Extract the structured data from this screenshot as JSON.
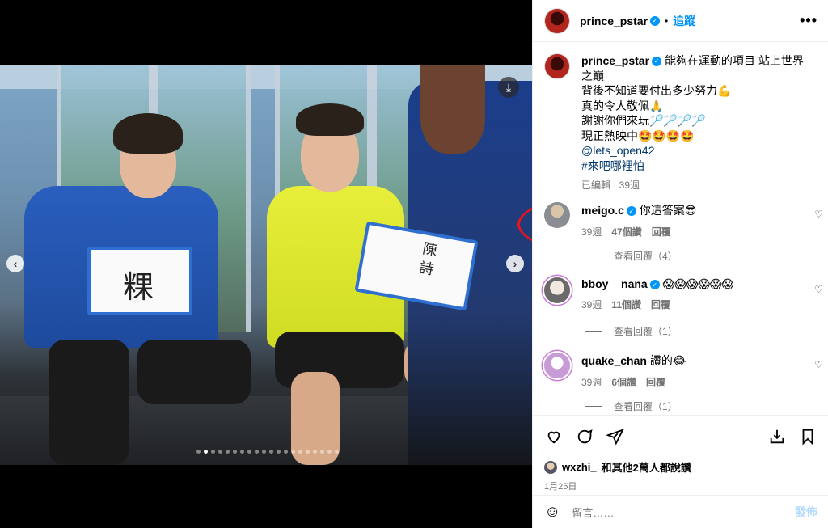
{
  "header": {
    "username": "prince_pstar",
    "separator": "•",
    "follow_label": "追蹤",
    "more_label": "•••"
  },
  "caption": {
    "username": "prince_pstar",
    "lines": [
      "能夠在運動的項目 站上世界之巔",
      "背後不知道要付出多少努力💪",
      "真的令人敬佩🙏",
      "謝謝你們來玩🏸🏸🏸🏸",
      "現正熱映中🤩🤩🤩🤩"
    ],
    "mention": "@lets_open42",
    "hashtag": "#來吧哪裡怕",
    "meta": "已編輯 · 39週"
  },
  "comments": [
    {
      "username": "meigo.c",
      "text": "你這答案😎",
      "time": "39週",
      "likes": "47個讚",
      "reply": "回覆",
      "view_replies": "查看回覆（4）"
    },
    {
      "username": "bboy__nana",
      "text": "😱😱😱😱😱😱",
      "time": "39週",
      "likes": "11個讚",
      "reply": "回覆",
      "view_replies": "查看回覆（1）"
    },
    {
      "username": "quake_chan",
      "text": "讚的😂",
      "time": "39週",
      "likes": "6個讚",
      "reply": "回覆",
      "view_replies": "查看回覆（1）"
    }
  ],
  "likes_line": {
    "user": "wxzhi_",
    "text": "和其他2萬人都說讚"
  },
  "post_date": "1月25日",
  "comment_box": {
    "placeholder": "留言……",
    "post_label": "發佈"
  },
  "media": {
    "board_left_text": "粿",
    "board_right_text": "陳\n詩",
    "carousel_total": 20,
    "carousel_active": 2
  },
  "colors": {
    "accent": "#0095f6",
    "annotation": "#e8141b",
    "board_frame": "#2f6fd0"
  },
  "icons": [
    "download-icon",
    "chevron-left-icon",
    "chevron-right-icon",
    "heart-icon",
    "comment-icon",
    "share-icon",
    "save-post-icon",
    "bookmark-icon",
    "emoji-icon",
    "verified-badge-icon",
    "more-options-icon"
  ]
}
